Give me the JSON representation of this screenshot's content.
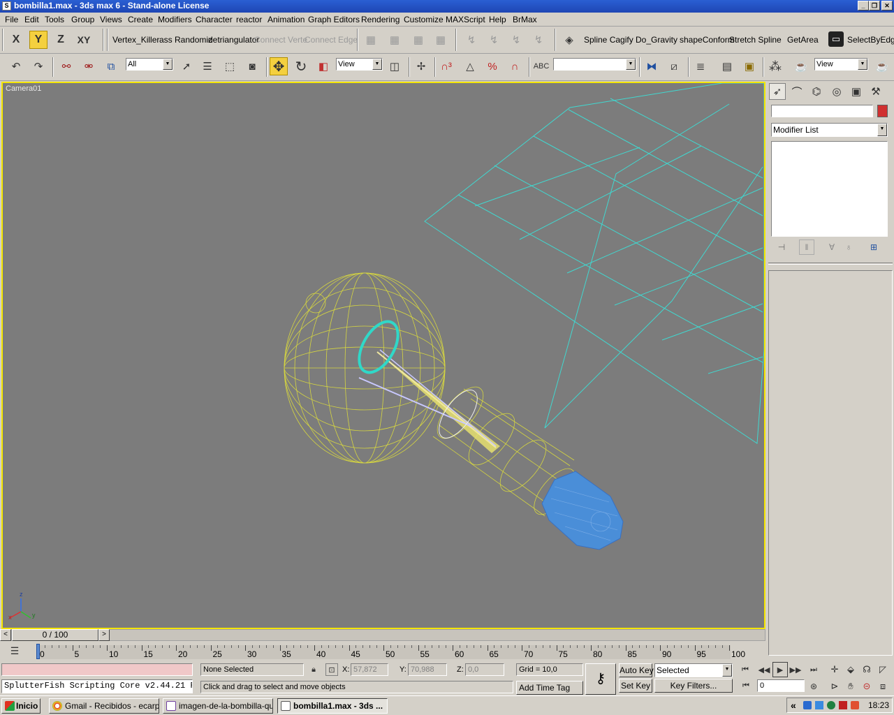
{
  "window": {
    "title": "bombilla1.max - 3ds max 6 - Stand-alone License",
    "app_icon": "3ds-max-icon"
  },
  "menu": [
    "File",
    "Edit",
    "Tools",
    "Group",
    "Views",
    "Create",
    "Modifiers",
    "Character",
    "reactor",
    "Animation",
    "Graph Editors",
    "Rendering",
    "Customize",
    "MAXScript",
    "Help",
    "BrMax"
  ],
  "axis_buttons": [
    "X",
    "Y",
    "Z",
    "XY"
  ],
  "scripts_bar": {
    "items": [
      "Vertex_Killer",
      "ass Randomiz",
      "detriangulator"
    ],
    "disabled": [
      "Connect Verte",
      "Connect Edge"
    ]
  },
  "scripts_bar2": [
    "Spline Cagify",
    "Do_Gravity",
    "shapeConform",
    "Stretch Spline",
    "GetArea",
    "SelectByEdge"
  ],
  "main_toolbar": {
    "selection_filter": "All",
    "ref_coord": "View",
    "named_selection": "",
    "render_view": "View"
  },
  "viewport": {
    "label": "Camera01",
    "axis_z": "z",
    "axis_x": "x",
    "axis_y": "y",
    "bg_color": "#7c7c7c",
    "border_color": "#f5e600"
  },
  "command_panel": {
    "modifier_list": "Modifier List",
    "object_color": "#d03030"
  },
  "time": {
    "slider_label": "0 / 100",
    "ticks": [
      "0",
      "5",
      "10",
      "15",
      "20",
      "25",
      "30",
      "35",
      "40",
      "45",
      "50",
      "55",
      "60",
      "65",
      "70",
      "75",
      "80",
      "85",
      "90",
      "95",
      "100"
    ]
  },
  "status": {
    "maxscript_listener": "SplutterFish Scripting Core v2.44.21 Ri",
    "selection": "None Selected",
    "prompt": "Click and drag to select and move objects",
    "x_label": "X:",
    "x": "57,872",
    "y_label": "Y:",
    "y": "70,988",
    "z_label": "Z:",
    "z": "0,0",
    "grid": "Grid = 10,0",
    "add_time_tag": "Add Time Tag",
    "auto_key": "Auto Key",
    "set_key": "Set Key",
    "key_mode": "Selected",
    "key_filters": "Key Filters...",
    "current_frame": "0"
  },
  "taskbar": {
    "start": "Inicio",
    "tasks": [
      "Gmail - Recibidos - ecarp...",
      "imagen-de-la-bombilla-que...",
      "bombilla1.max - 3ds ..."
    ],
    "tray_arrow": "«",
    "clock": "18:23"
  }
}
